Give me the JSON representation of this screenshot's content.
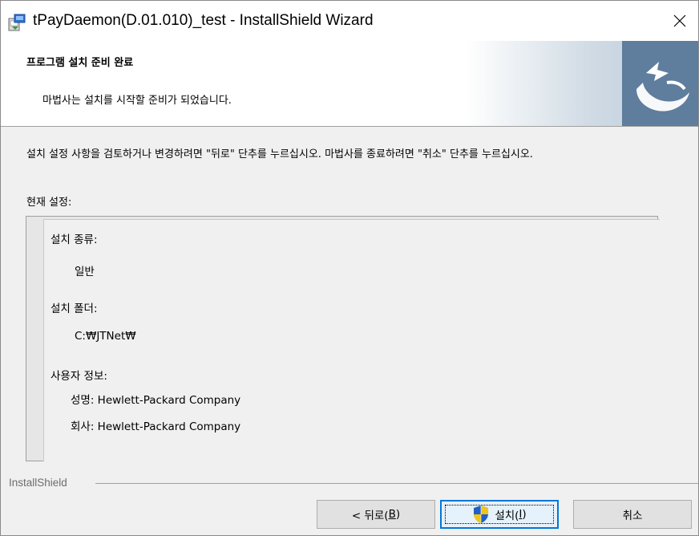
{
  "window": {
    "title": "tPayDaemon(D.01.010)_test - InstallShield Wizard"
  },
  "icons": {
    "app": "installer-icon",
    "close": "close-icon",
    "logo": "installshield-logo-icon",
    "shield": "uac-shield-icon"
  },
  "banner": {
    "title": "프로그램 설치 준비 완료",
    "subtitle": "마법사는 설치를 시작할 준비가 되었습니다."
  },
  "body": {
    "description": "설치 설정 사항을 검토하거나 변경하려면 \"뒤로\" 단추를 누르십시오. 마법사를 종료하려면 \"취소\" 단추를 누르십시오.",
    "current_settings_label": "현재 설정:",
    "settings": {
      "setup_type_label": "설치 종류:",
      "setup_type_value": "일반",
      "folder_label": "설치 폴더:",
      "folder_value": "C:₩JTNet₩",
      "user_info_label": "사용자 정보:",
      "name_line": "성명: Hewlett-Packard Company",
      "company_line": "회사: Hewlett-Packard Company"
    }
  },
  "footer": {
    "brand": "InstallShield",
    "back_label": "< 뒤로(",
    "back_key": "B",
    "install_label": "설치(",
    "install_key": "I",
    "key_close": ")",
    "cancel_label": "취소"
  },
  "colors": {
    "accent": "#0078d7",
    "logo_bg": "#5f7d9d"
  }
}
